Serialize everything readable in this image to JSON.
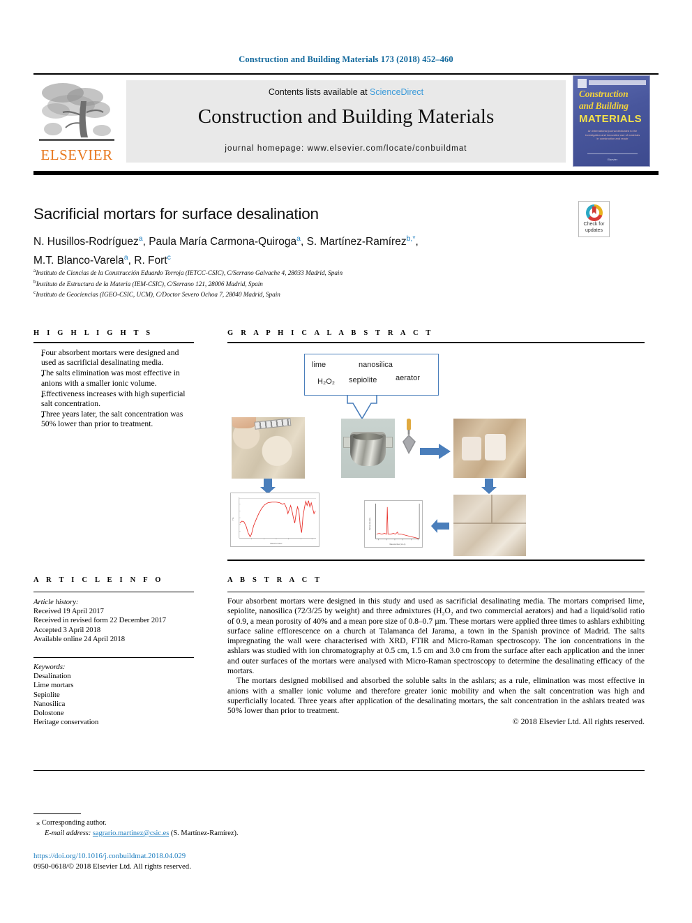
{
  "running_head": "Construction and Building Materials 173 (2018) 452–460",
  "masthead": {
    "publisher": "ELSEVIER",
    "contents_prefix": "Contents lists available at ",
    "contents_link": "ScienceDirect",
    "journal_title": "Construction and Building Materials",
    "homepage": "journal homepage: www.elsevier.com/locate/conbuildmat",
    "cover": {
      "line1": "Construction",
      "line2": "and Building",
      "line3": "MATERIALS",
      "blurb": "An international journal dedicated to the investigation and innovative use of materials in construction and repair",
      "foot": "Elsevier"
    }
  },
  "article": {
    "title": "Sacrificial mortars for surface desalination",
    "authors_line1_a": "N. Husillos-Rodríguez",
    "authors_sup1": "a",
    "authors_line1_b": ", Paula María Carmona-Quiroga",
    "authors_sup2": "a",
    "authors_line1_c": ", S. Martínez-Ramírez",
    "authors_sup3": "b,",
    "authors_star": "*",
    "authors_line2_a": "M.T. Blanco-Varela",
    "authors_sup4": "a",
    "authors_line2_b": ", R. Fort",
    "authors_sup5": "c",
    "affiliations": [
      {
        "marker": "a",
        "text": "Instituto de Ciencias de la Construcción Eduardo Torroja (IETCC-CSIC), C/Serrano Galvache 4, 28033 Madrid, Spain"
      },
      {
        "marker": "b",
        "text": "Instituto de Estructura de la Materia (IEM-CSIC), C/Serrano 121, 28006 Madrid, Spain"
      },
      {
        "marker": "c",
        "text": "Instituto de Geociencias (IGEO-CSIC, UCM), C/Doctor Severo Ochoa 7, 28040 Madrid, Spain"
      }
    ]
  },
  "crossmark": {
    "line1": "Check for",
    "line2": "updates"
  },
  "highlights": {
    "heading": "H I G H L I G H T S",
    "items": [
      "Four absorbent mortars were designed and used as sacrificial desalinating media.",
      "The salts elimination was most effective in anions with a smaller ionic volume.",
      "Effectiveness increases with high superficial salt concentration.",
      "Three years later, the salt concentration was 50% lower than prior to treatment."
    ]
  },
  "graphical_abstract": {
    "heading": "G R A P H I C A L   A B S T R A C T",
    "ingredients": {
      "lime": "lime",
      "nanosilica": "nanosilica",
      "h2o2": "H₂O₂",
      "sepiolite": "sepiolite",
      "aerator": "aerator"
    },
    "panels": [
      "salt-efflorescence-wall-photo",
      "mortar-mixing-bowl-photo",
      "trowel-photo",
      "mortar-applied-to-ashlar-photo",
      "treated-ashlar-photo",
      "ftir-spectrum-plot",
      "raman-spectrum-plot"
    ]
  },
  "article_info": {
    "heading": "A R T I C L E   I N F O",
    "history_label": "Article history:",
    "history": [
      "Received 19 April 2017",
      "Received in revised form 22 December 2017",
      "Accepted 3 April 2018",
      "Available online 24 April 2018"
    ],
    "keywords_label": "Keywords:",
    "keywords": [
      "Desalination",
      "Lime mortars",
      "Sepiolite",
      "Nanosilica",
      "Dolostone",
      "Heritage conservation"
    ]
  },
  "abstract": {
    "heading": "A B S T R A C T",
    "para1": "Four absorbent mortars were designed in this study and used as sacrificial desalinating media. The mortars comprised lime, sepiolite, nanosilica (72/3/25 by weight) and three admixtures (H₂O₂ and two commercial aerators) and had a liquid/solid ratio of 0.9, a mean porosity of 40% and a mean pore size of 0.8–0.7 µm. These mortars were applied three times to ashlars exhibiting surface saline efflorescence on a church at Talamanca del Jarama, a town in the Spanish province of Madrid. The salts impregnating the wall were characterised with XRD, FTIR and Micro-Raman spectroscopy. The ion concentrations in the ashlars was studied with ion chromatography at 0.5 cm, 1.5 cm and 3.0 cm from the surface after each application and the inner and outer surfaces of the mortars were analysed with Micro-Raman spectroscopy to determine the desalinating efficacy of the mortars.",
    "para2": "The mortars designed mobilised and absorbed the soluble salts in the ashlars; as a rule, elimination was most effective in anions with a smaller ionic volume and therefore greater ionic mobility and when the salt concentration was high and superficially located. Three years after application of the desalinating mortars, the salt concentration in the ashlars treated was 50% lower than prior to treatment.",
    "rights": "© 2018 Elsevier Ltd. All rights reserved."
  },
  "footer": {
    "corresponding_star": "⁎",
    "corresponding": "Corresponding author.",
    "email_label": "E-mail address:",
    "email": "sagrario.martinez@csic.es",
    "email_owner": "(S. Martínez-Ramírez).",
    "doi": "https://doi.org/10.1016/j.conbuildmat.2018.04.029",
    "issn": "0950-0618/© 2018 Elsevier Ltd. All rights reserved."
  },
  "colors": {
    "journal_blue": "#11689c",
    "link_blue": "#1f7fc0",
    "sciencedirect_blue": "#3a9ad9",
    "elsevier_orange": "#e87a22",
    "arrow_blue": "#4a7ebb",
    "spectrum_red": "#e8302a"
  }
}
